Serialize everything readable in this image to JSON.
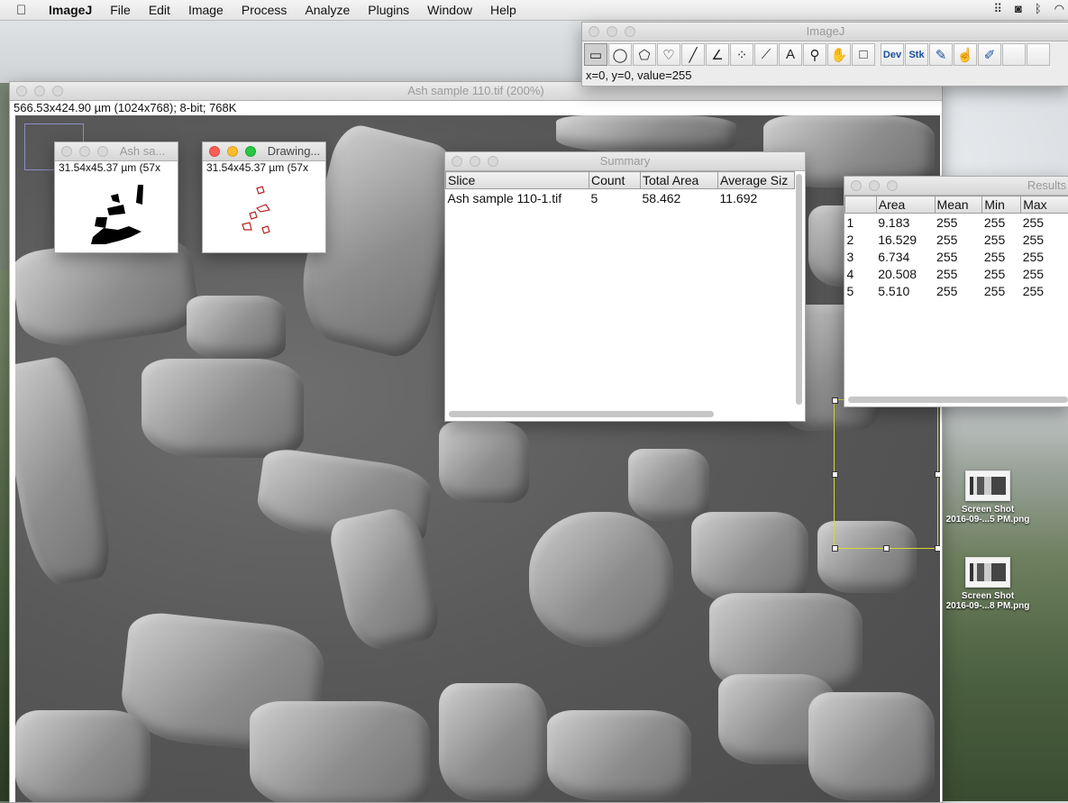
{
  "menubar": {
    "app": "ImageJ",
    "items": [
      "File",
      "Edit",
      "Image",
      "Process",
      "Analyze",
      "Plugins",
      "Window",
      "Help"
    ]
  },
  "toolbar": {
    "title": "ImageJ",
    "status": "x=0, y=0, value=255",
    "dev_label": "Dev",
    "stk_label": "Stk"
  },
  "image_window": {
    "title": "Ash sample 110.tif (200%)",
    "info": "566.53x424.90 µm (1024x768); 8-bit; 768K"
  },
  "mask_window": {
    "title": "Ash sa...",
    "info": "31.54x45.37 µm (57x"
  },
  "drawing_window": {
    "title": "Drawing...",
    "info": "31.54x45.37 µm (57x"
  },
  "summary": {
    "title": "Summary",
    "headers": [
      "Slice",
      "Count",
      "Total Area",
      "Average Siz"
    ],
    "rows": [
      [
        "Ash sample 110-1.tif",
        "5",
        "58.462",
        "11.692"
      ]
    ]
  },
  "results": {
    "title": "Results",
    "headers": [
      "",
      "Area",
      "Mean",
      "Min",
      "Max"
    ],
    "rows": [
      [
        "1",
        "9.183",
        "255",
        "255",
        "255"
      ],
      [
        "2",
        "16.529",
        "255",
        "255",
        "255"
      ],
      [
        "3",
        "6.734",
        "255",
        "255",
        "255"
      ],
      [
        "4",
        "20.508",
        "255",
        "255",
        "255"
      ],
      [
        "5",
        "5.510",
        "255",
        "255",
        "255"
      ]
    ]
  },
  "desktop": {
    "icon1_line1": "Screen Shot",
    "icon1_line2": "2016-09-...5 PM.png",
    "icon2_line1": "Screen Shot",
    "icon2_line2": "2016-09-...8 PM.png"
  }
}
